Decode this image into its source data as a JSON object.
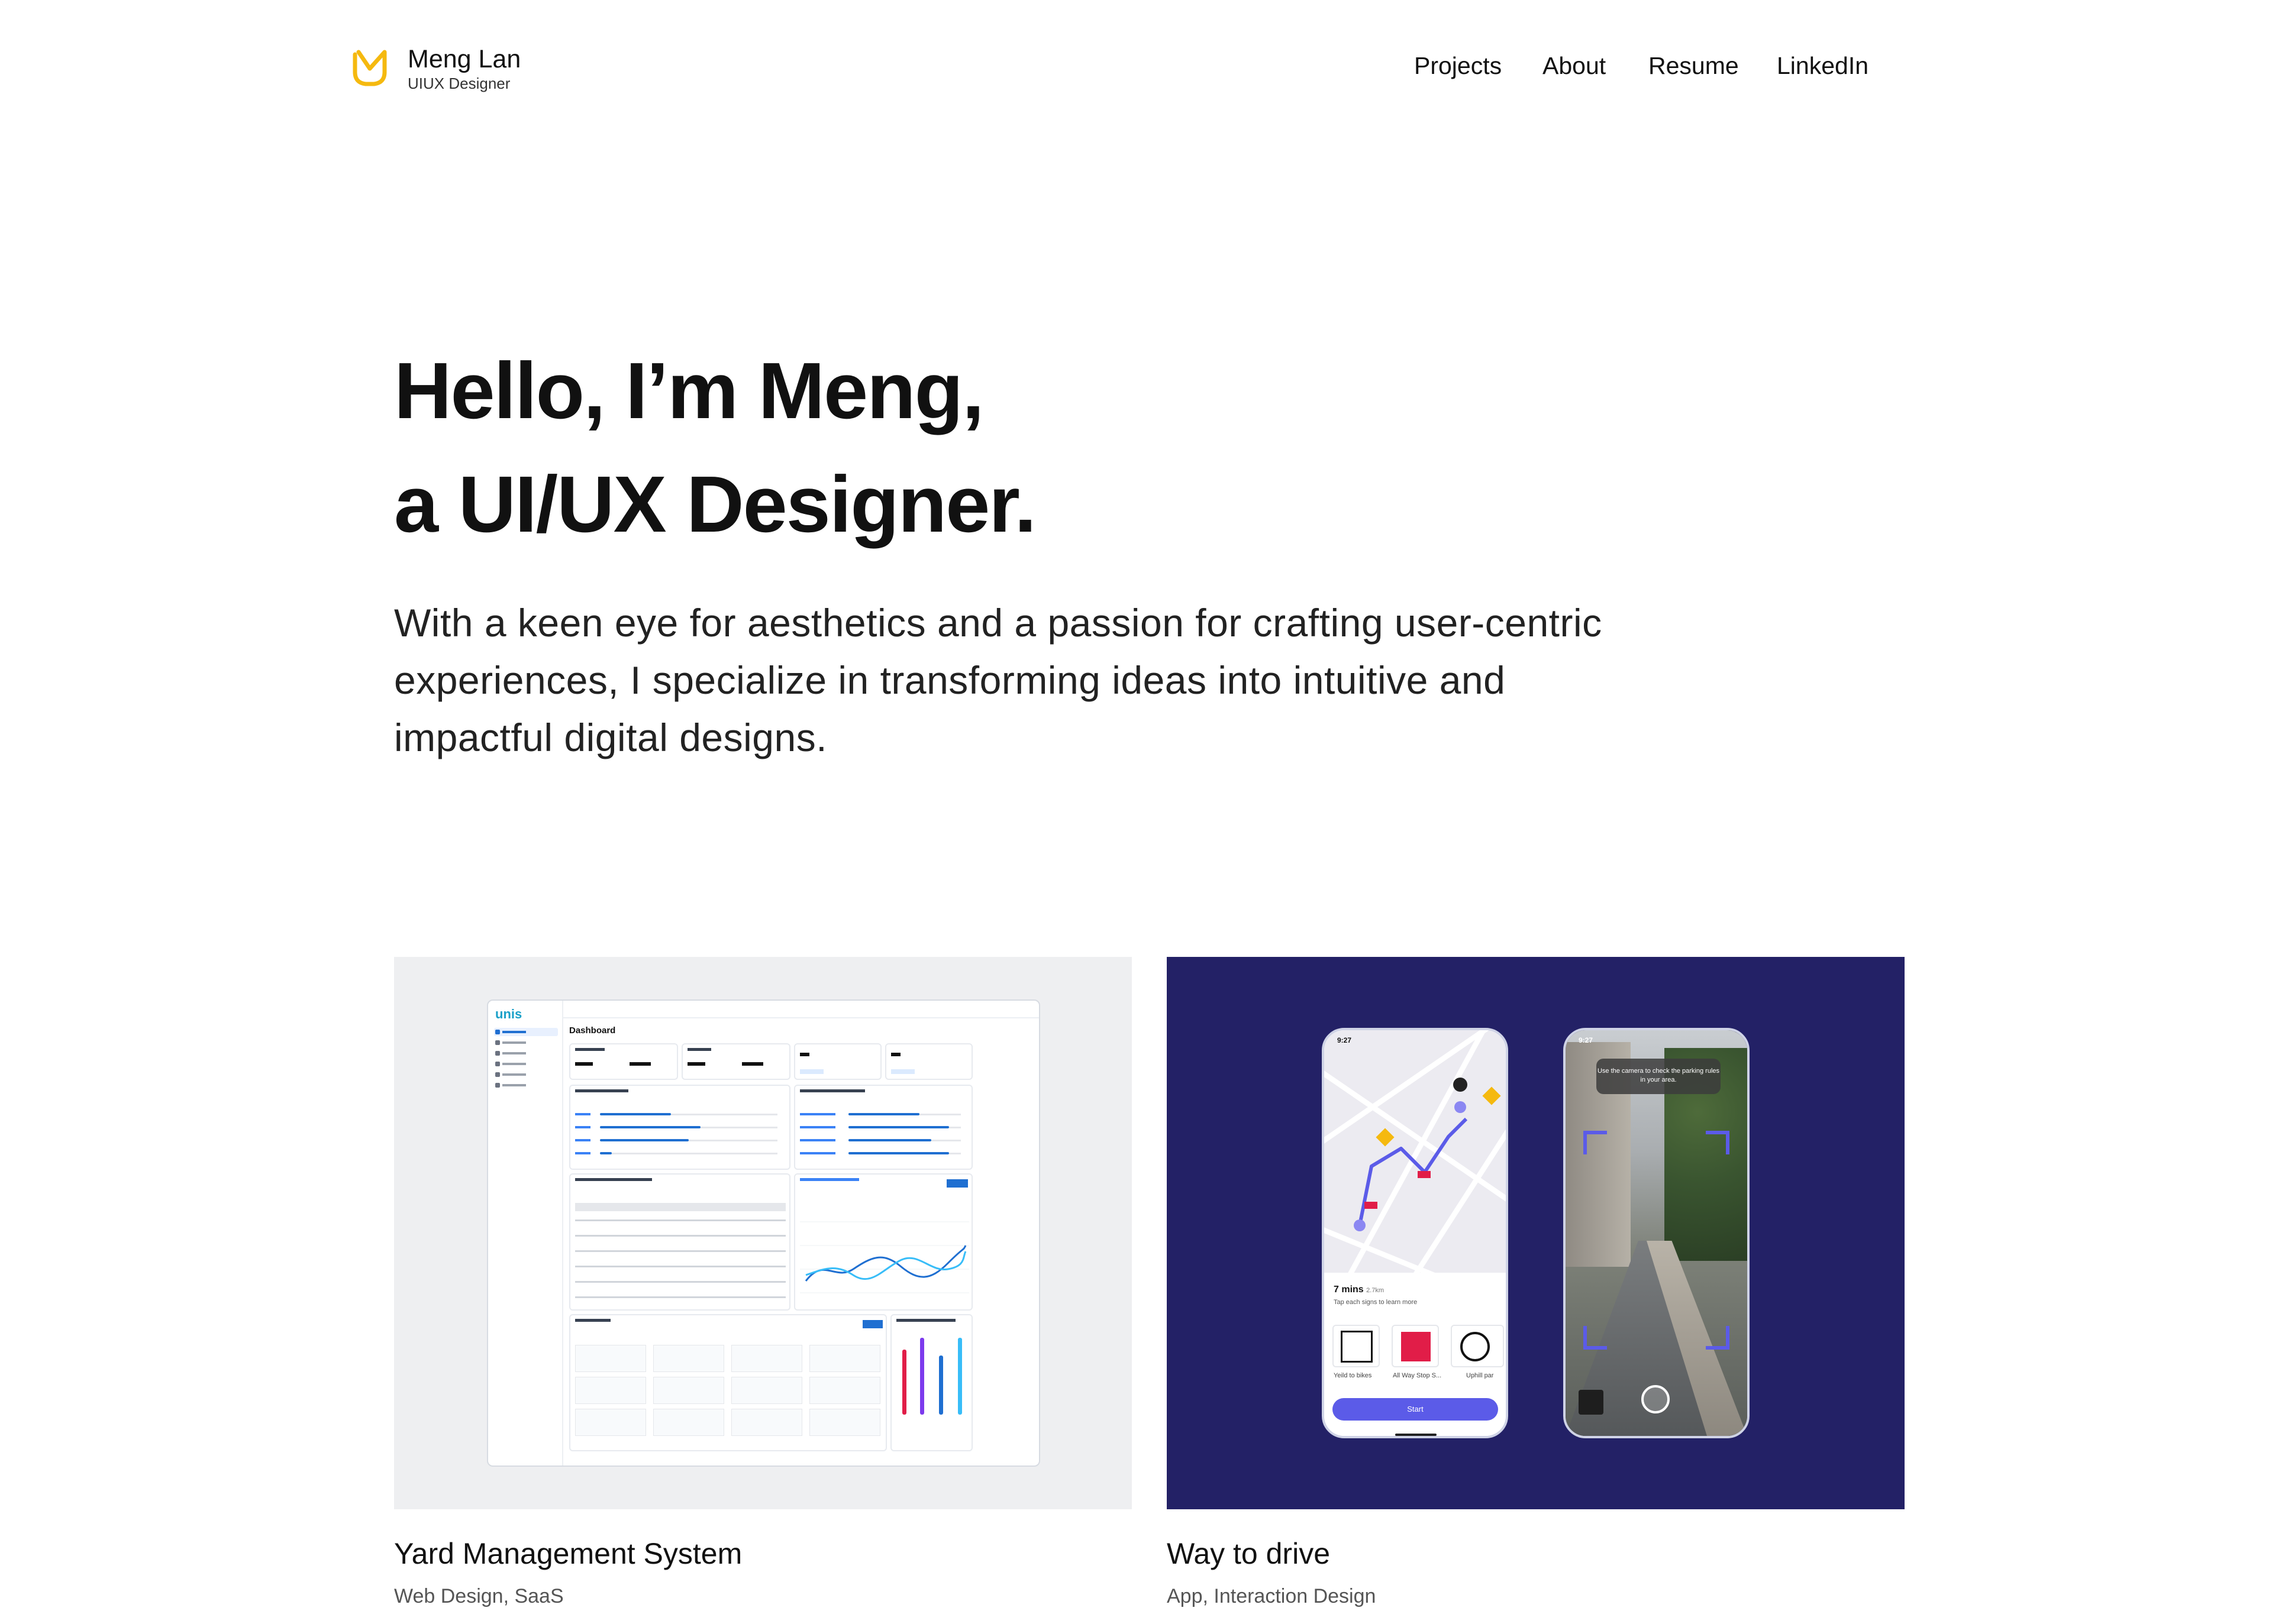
{
  "header": {
    "brand_name": "Meng Lan",
    "brand_subtitle": "UIUX Designer",
    "logo_icon": "m-logo-icon",
    "nav": [
      "Projects",
      "About",
      "Resume",
      "LinkedIn"
    ]
  },
  "hero": {
    "line1": "Hello, I’m Meng,",
    "line2": "a UI/UX Designer.",
    "description": "With a keen eye for aesthetics and a passion for crafting user-centric experiences, I specialize in transforming ideas into intuitive and impactful digital designs."
  },
  "projects": [
    {
      "title": "Yard Management System",
      "tags": "Web Design, SaaS",
      "thumbnail": {
        "app_logo": "unis",
        "page_title": "Dashboard"
      }
    },
    {
      "title": "Way to drive",
      "tags": "App, Interaction Design",
      "thumbnail": {
        "time": "9:27",
        "eta": "7 mins",
        "distance": "2.7km",
        "hint": "Tap each signs to learn more",
        "signs": [
          "Yeild to bikes",
          "All Way Stop S...",
          "Uphill par"
        ],
        "start_label": "Start",
        "camera_tip": "Use the camera to check the parking rules in your area."
      }
    }
  ],
  "colors": {
    "accent_yellow": "#f5b90f",
    "drive_bg": "#232166",
    "yard_bg": "#eeeff1",
    "button_purple": "#5b5be8"
  }
}
